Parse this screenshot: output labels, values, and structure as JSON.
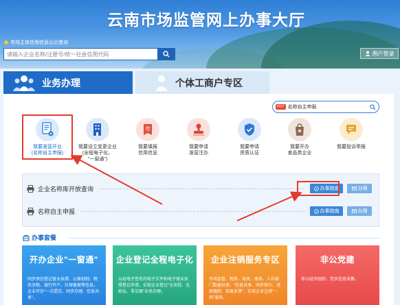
{
  "header": {
    "title": "云南市场监管网上办事大厅",
    "credit_link": "市场主体信用信息公示查询",
    "search_placeholder": "请输入企业名称/注册号/统一社会信用代码",
    "login_label": "用户登录"
  },
  "tabs": [
    {
      "label": "业务办理"
    },
    {
      "label": "个体工商户专区"
    }
  ],
  "service_search": {
    "tag": "HOT",
    "placeholder": "名称自主申报"
  },
  "services": [
    {
      "label": "我要准营开业\n(名称自主申报)",
      "icon": "document-gear-icon"
    },
    {
      "label": "我要设立变更企业\n(全程电子化、\n\"一窗通\")",
      "icon": "building-icon"
    },
    {
      "label": "我要填报\n信用信息",
      "icon": "credit-icon"
    },
    {
      "label": "我要申请\n准营注办",
      "icon": "stamp-icon"
    },
    {
      "label": "我要申请\n资质认证",
      "icon": "shield-check-icon"
    },
    {
      "label": "我要开办\n食品类企业",
      "icon": "food-bag-icon"
    },
    {
      "label": "我要投诉举报",
      "icon": "complaint-icon"
    }
  ],
  "expanded": {
    "rows": [
      {
        "label": "企业名称库开放查询"
      },
      {
        "label": "名称自主申报"
      }
    ],
    "guide_label": "办事指南",
    "do_label": "办理"
  },
  "section": {
    "title": "办事套餐"
  },
  "cards": [
    {
      "title": "开办企业\"一窗通\"",
      "desc": "同步承办登记营业执照、公章刻制、税务涉税、银行开户、社保备案等信息。企业开办\"一次提交、同步办理、信息共享\"。",
      "color": "#2a8ce0"
    },
    {
      "title": "企业登记全程电子化",
      "desc": "以经电子签名的电子文件和电子营业执照登记申请，实现企业登记\"全流程、无纸化、零见面\"业务办理。",
      "color": "#2cb088"
    },
    {
      "title": "企业注销服务专区",
      "desc": "市场监管、税务、海关、商务、人社部门数据共享，\"信息共享、同步指引、进度跟踪、结果反馈\"，实现企业注销\"一网\"服务。",
      "color": "#f3952f"
    },
    {
      "title": "非公党建",
      "desc": "非公经济组织、党员信息采集。",
      "color": "#ee5652"
    }
  ]
}
